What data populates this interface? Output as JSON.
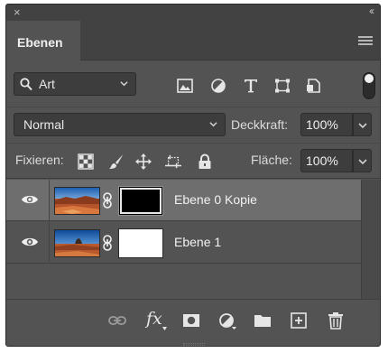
{
  "panel": {
    "close_glyph": "×",
    "collapse_glyph": "‹‹",
    "tab_label": "Ebenen",
    "menu_icon": "hamburger-menu-icon"
  },
  "filter": {
    "kind_label": "Art",
    "icons": [
      "pixel-layer-filter-icon",
      "adjustment-layer-filter-icon",
      "type-layer-filter-icon",
      "shape-layer-filter-icon",
      "smart-object-filter-icon"
    ],
    "toggle_state": "on"
  },
  "blend": {
    "mode": "Normal",
    "opacity_label": "Deckkraft:",
    "opacity_value": "100%"
  },
  "lock": {
    "label": "Fixieren:",
    "icons": [
      "lock-transparent-pixels-icon",
      "lock-image-pixels-icon",
      "lock-position-icon",
      "prevent-autonest-icon",
      "lock-all-icon"
    ],
    "fill_label": "Fläche:",
    "fill_value": "100%"
  },
  "layers": [
    {
      "name": "Ebene 0 Kopie",
      "visible": true,
      "selected": true,
      "mask": "black"
    },
    {
      "name": "Ebene 1",
      "visible": true,
      "selected": false,
      "mask": "white"
    }
  ],
  "bottom_bar": {
    "fx_label": "fx",
    "icons": [
      "link-layers-icon",
      "fx-icon",
      "add-mask-icon",
      "new-adjustment-layer-icon",
      "new-group-icon",
      "new-layer-icon",
      "delete-layer-icon"
    ]
  },
  "colors": {
    "panel_bg": "#535353",
    "selected_row": "#6e6e6e",
    "field_bg": "#3d3d3d"
  }
}
